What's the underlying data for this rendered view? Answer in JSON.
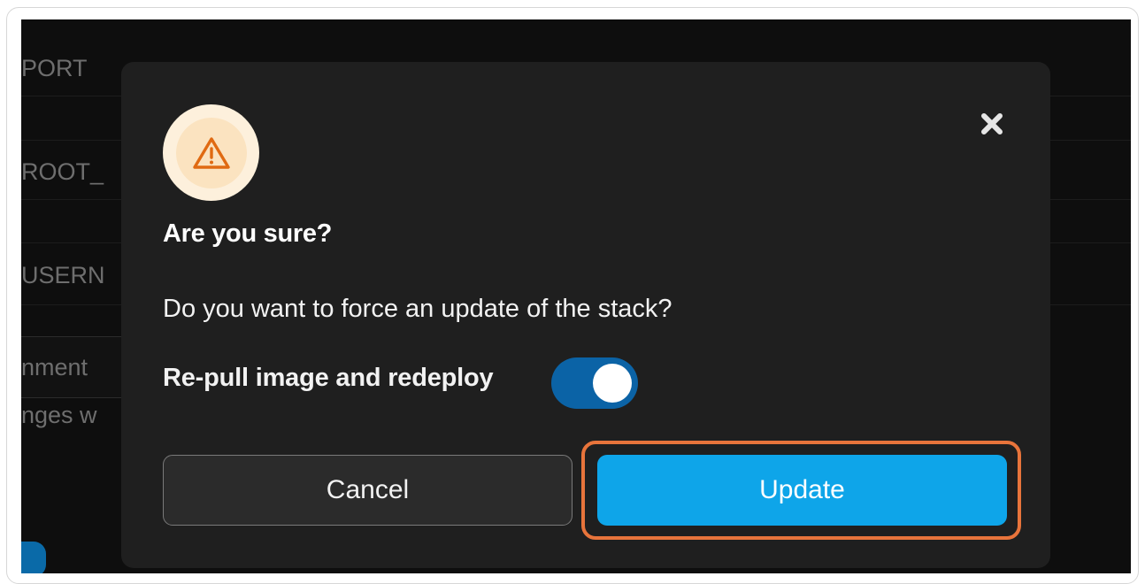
{
  "background": {
    "rows": [
      "PORT",
      "ROOT_",
      "USERN",
      "nment",
      "nges w"
    ]
  },
  "dialog": {
    "warning_icon": "warning-triangle-icon",
    "close_icon": "close-x-icon",
    "title": "Are you sure?",
    "message": "Do you want to force an update of the stack?",
    "toggle": {
      "label": "Re-pull image and redeploy",
      "checked": true
    },
    "cancel_label": "Cancel",
    "confirm_label": "Update"
  },
  "colors": {
    "confirm_button": "#0ea5e9",
    "toggle_on": "#0b63a6",
    "highlight_outline": "#e8743b",
    "warning_icon": "#e06a12"
  }
}
